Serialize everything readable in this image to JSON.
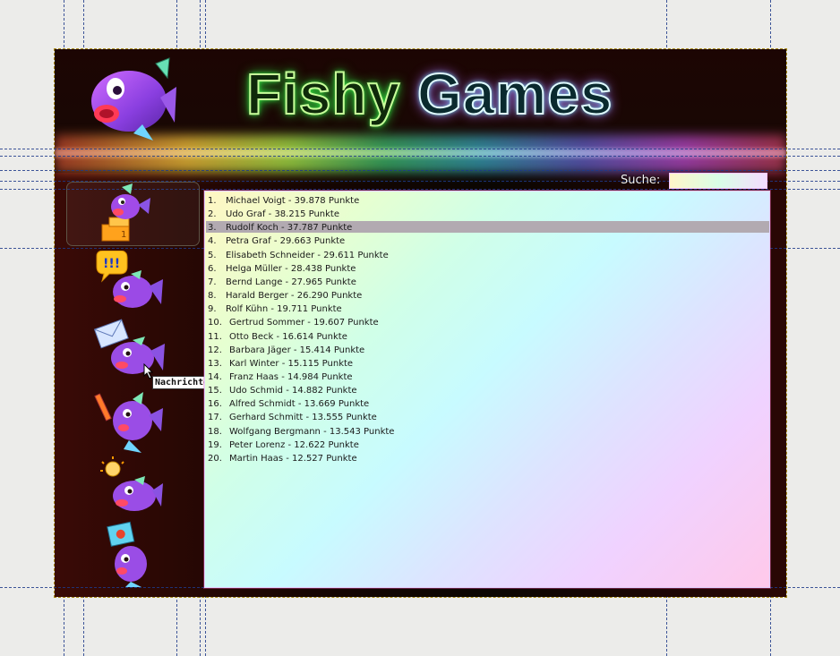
{
  "app": {
    "title": "Fishy Games"
  },
  "search": {
    "label": "Suche:",
    "value": ""
  },
  "sidebar": {
    "icons": [
      {
        "name": "trophy-fish-icon",
        "selected": true
      },
      {
        "name": "chat-alert-fish-icon",
        "selected": false
      },
      {
        "name": "mail-fish-icon",
        "selected": false
      },
      {
        "name": "paintbrush-fish-icon",
        "selected": false
      },
      {
        "name": "lightbulb-fish-icon",
        "selected": false
      },
      {
        "name": "picture-fish-icon",
        "selected": false
      }
    ],
    "tooltip": "Nachrichten"
  },
  "scoreboard": {
    "highlighted_rank": 3,
    "rows": [
      {
        "rank": "1.",
        "text": "Michael Voigt - 39.878 Punkte"
      },
      {
        "rank": "2.",
        "text": "Udo Graf - 38.215 Punkte"
      },
      {
        "rank": "3.",
        "text": "Rudolf Koch - 37.787 Punkte"
      },
      {
        "rank": "4.",
        "text": "Petra Graf - 29.663 Punkte"
      },
      {
        "rank": "5.",
        "text": "Elisabeth Schneider - 29.611 Punkte"
      },
      {
        "rank": "6.",
        "text": "Helga Müller - 28.438 Punkte"
      },
      {
        "rank": "7.",
        "text": "Bernd Lange - 27.965 Punkte"
      },
      {
        "rank": "8.",
        "text": "Harald Berger - 26.290 Punkte"
      },
      {
        "rank": "9.",
        "text": "Rolf Kühn - 19.711 Punkte"
      },
      {
        "rank": "10.",
        "text": "Gertrud Sommer - 19.607 Punkte"
      },
      {
        "rank": "11.",
        "text": "Otto Beck - 16.614 Punkte"
      },
      {
        "rank": "12.",
        "text": "Barbara Jäger - 15.414 Punkte"
      },
      {
        "rank": "13.",
        "text": "Karl Winter - 15.115 Punkte"
      },
      {
        "rank": "14.",
        "text": "Franz Haas - 14.984 Punkte"
      },
      {
        "rank": "15.",
        "text": "Udo Schmid - 14.882 Punkte"
      },
      {
        "rank": "16.",
        "text": "Alfred Schmidt - 13.669 Punkte"
      },
      {
        "rank": "17.",
        "text": "Gerhard Schmitt - 13.555 Punkte"
      },
      {
        "rank": "18.",
        "text": "Wolfgang Bergmann - 13.543 Punkte"
      },
      {
        "rank": "19.",
        "text": "Peter Lorenz - 12.622 Punkte"
      },
      {
        "rank": "20.",
        "text": "Martin Haas - 12.527 Punkte"
      }
    ]
  },
  "colors": {
    "title_green_glow": "#39ff4a",
    "title_cyan_glow": "#6ff1ff",
    "row_highlight": "#b2aab1"
  }
}
